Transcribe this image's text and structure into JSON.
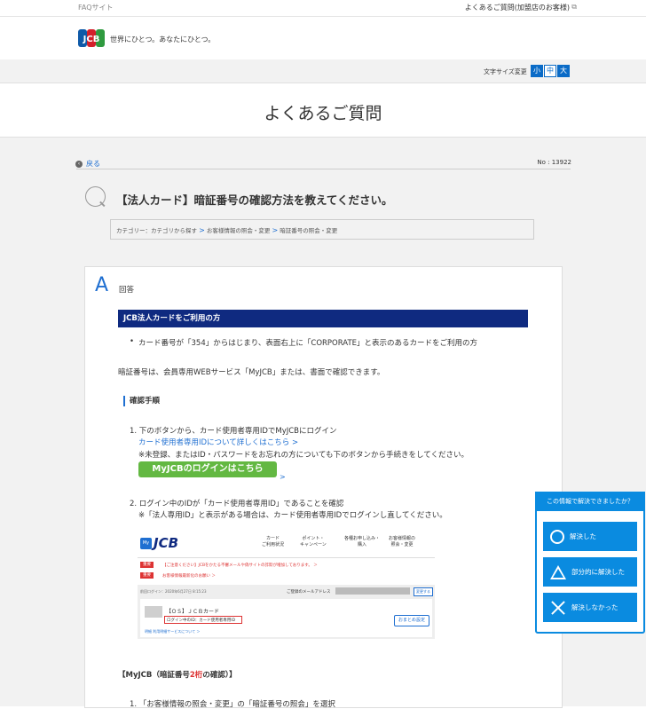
{
  "topbar": {
    "site": "FAQサイト",
    "link": "よくあるご質問(加盟店のお客様)",
    "ext_icon": "external-link-icon"
  },
  "brand": {
    "logo_text": "JCB",
    "tagline": "世界にひとつ。あなたにひとつ。",
    "colors": {
      "blue": "#0f5aa8",
      "red": "#d3202a",
      "green": "#2f9a3f"
    }
  },
  "font_size": {
    "label": "文字サイズ変更",
    "small": "小",
    "medium": "中",
    "large": "大"
  },
  "page_title": "よくあるご質問",
  "back": "戻る",
  "question_no": "No : 13922",
  "question": "【法人カード】暗証番号の確認方法を教えてください。",
  "breadcrumb": {
    "prefix": "カテゴリー：",
    "items": [
      "カテゴリから探す",
      "お客様情報の照会・変更",
      "暗証番号の照会・変更"
    ]
  },
  "answer": {
    "label": "回答",
    "bar": "JCB法人カードをご利用の方",
    "bullet": "カード番号が「354」からはじまり、表面右上に「CORPORATE」と表示のあるカードをご利用の方",
    "intro": "暗証番号は、会員専用WEBサービス「MyJCB」または、書面で確認できます。",
    "section": "確認手順",
    "step1": "1. 下のボタンから、カード使用者専用IDでMyJCBにログイン",
    "step1_link": "カード使用者専用IDについて詳しくはこちら",
    "step1_note": "※未登録、またはID・パスワードをお忘れの方についても下のボタンから手続きをしてください。",
    "login_button": "MyJCBのログインはこちら",
    "step2": "2. ログイン中のIDが「カード使用者専用ID」であることを確認",
    "step2_note": "※「法人専用ID」と表示がある場合は、カード使用者専用IDでログインし直してください。",
    "sub_heading_a": "【MyJCB（暗証番号",
    "sub_heading_red": "2桁",
    "sub_heading_b": "の確認）】",
    "step3_partial": "1. 「お客様情報の照会・変更」の「暗証番号の照会」を選択"
  },
  "screenshot": {
    "my": "My",
    "logo": "JCB",
    "nav": [
      "カード\nご利用状況",
      "ポイント・\nキャンペーン",
      "各種お申し込み・\n購入",
      "お客様情報の\n照会・変更"
    ],
    "tag1": "重要",
    "notice1": "【ご注意ください】JCBをかたる不審メールや偽サイトの詐欺が増加しております。 ＞",
    "tag2": "重要",
    "notice2": "お客様情報最新化のお願い ＞",
    "last_login": "前回ログイン：2020年6月27日 8:15:23",
    "mail_label": "ご登録のメールアドレス",
    "mail_btn": "変更する",
    "card_name": "【ＯＳ】ＪＣＢカード",
    "login_id": "ログイン中のID：カード使用者専用ID",
    "links": "明細  利用明細サービスについて ＞",
    "omake": "おまとめ設定"
  },
  "feedback": {
    "title": "この情報で解決できましたか？",
    "solved": "解決した",
    "partial": "部分的に解決した",
    "unsolved": "解決しなかった"
  }
}
